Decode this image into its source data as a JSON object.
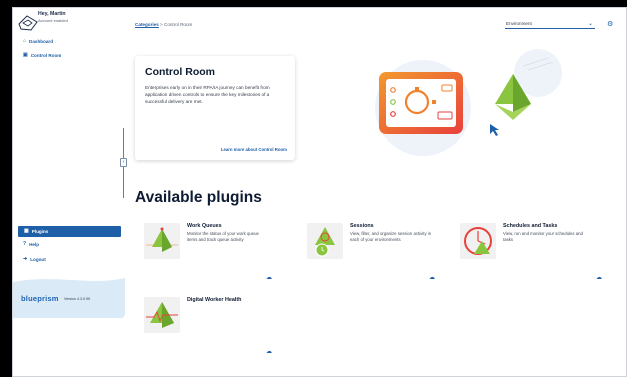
{
  "user": {
    "greeting": "Hey, Martin",
    "account": "Account enabled"
  },
  "nav": {
    "top": [
      {
        "label": "Dashboard",
        "icon": "home-icon"
      },
      {
        "label": "Control Room",
        "icon": "control-room-icon"
      }
    ],
    "plugins_label": "Plugins",
    "help_label": "Help",
    "logout_label": "Logout"
  },
  "brand": {
    "logo": "blueprism",
    "version": "Version 4.3.0.99"
  },
  "breadcrumb": {
    "parent": "Categories",
    "separator": " > ",
    "current": "Control Room"
  },
  "environment": {
    "value": "Environment"
  },
  "hero": {
    "title": "Control Room",
    "description": "Enterprises early on in their RPA/IA journey can benefit from application driven controls to ensure the key milestones of a successful delivery are met.",
    "link": "Learn more about Control Room"
  },
  "section_title": "Available plugins",
  "plugins": [
    {
      "name": "Work Queues",
      "description": "Monitor the status of your work queue items and track queue activity"
    },
    {
      "name": "Sessions",
      "description": "View, filter, and organize session activity in each of your environments"
    },
    {
      "name": "Schedules and Tasks",
      "description": "View, run and monitor your schedules and tasks"
    },
    {
      "name": "Digital Worker Health",
      "description": ""
    }
  ],
  "colors": {
    "accent": "#1f5fa8",
    "orange": "#f2812e",
    "green": "#8bc53f"
  }
}
